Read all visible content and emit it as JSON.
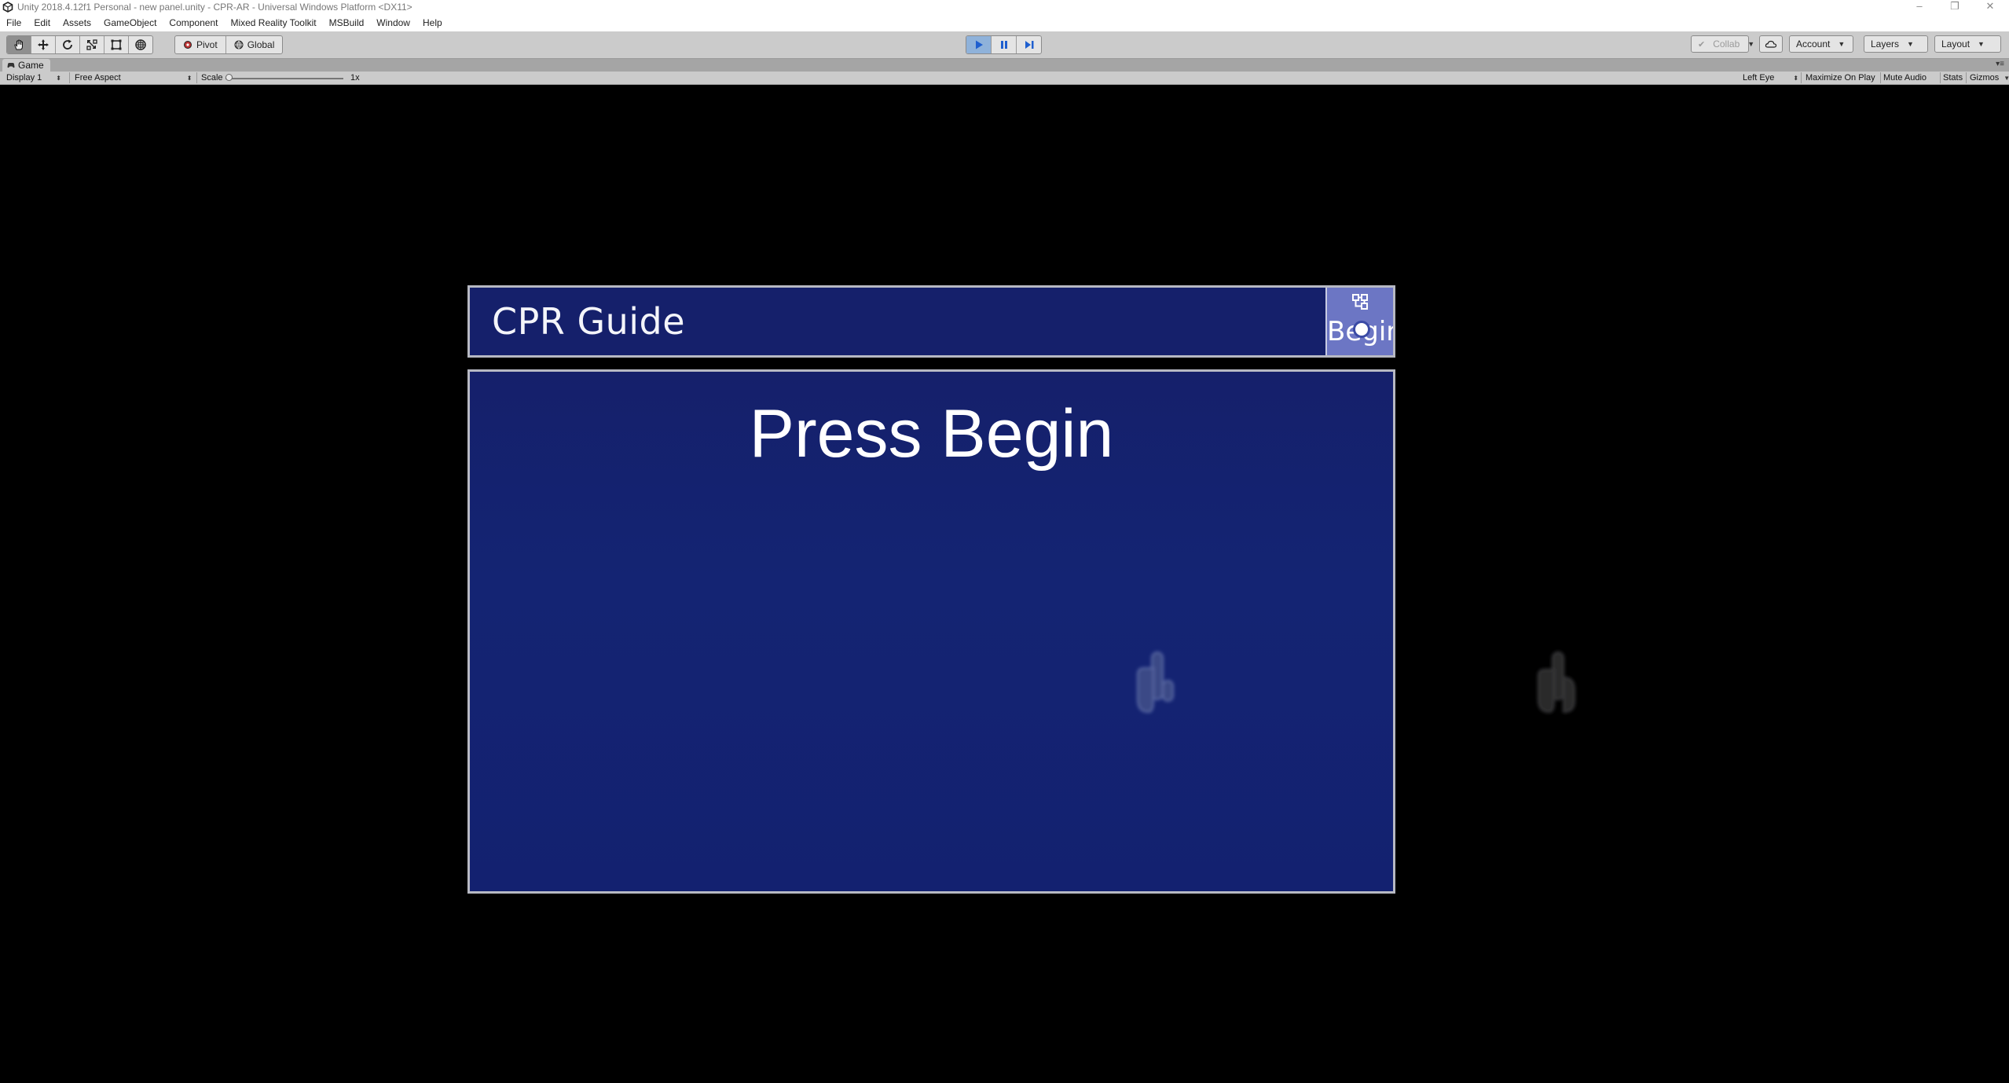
{
  "window": {
    "title": "Unity 2018.4.12f1 Personal - new panel.unity - CPR-AR - Universal Windows Platform <DX11>",
    "controls": [
      "–",
      "❐",
      "✕"
    ]
  },
  "menu": {
    "items": [
      "File",
      "Edit",
      "Assets",
      "GameObject",
      "Component",
      "Mixed Reality Toolkit",
      "MSBuild",
      "Window",
      "Help"
    ]
  },
  "toolbar": {
    "tools": [
      "hand-tool-icon",
      "move-tool-icon",
      "rotate-tool-icon",
      "scale-tool-icon",
      "rect-tool-icon",
      "transform-tool-icon"
    ],
    "pivot_label": "Pivot",
    "global_label": "Global",
    "collab_label": "Collab",
    "account_label": "Account",
    "layers_label": "Layers",
    "layout_label": "Layout",
    "play_state": "playing",
    "accent_color": "#3a7bd5"
  },
  "game_tab": {
    "label": "Game",
    "display": "Display 1",
    "aspect": "Free Aspect",
    "scale_label": "Scale",
    "scale_value": "1x",
    "scale_fraction": 0.0,
    "eye": "Left Eye",
    "maximize_on_play": "Maximize On Play",
    "mute_audio": "Mute Audio",
    "stats": "Stats",
    "gizmos": "Gizmos"
  },
  "scene": {
    "header_title": "CPR Guide",
    "begin_label": "Begin",
    "content_heading": "Press Begin",
    "panel_color": "#15206b",
    "button_color": "#6c76c4"
  }
}
